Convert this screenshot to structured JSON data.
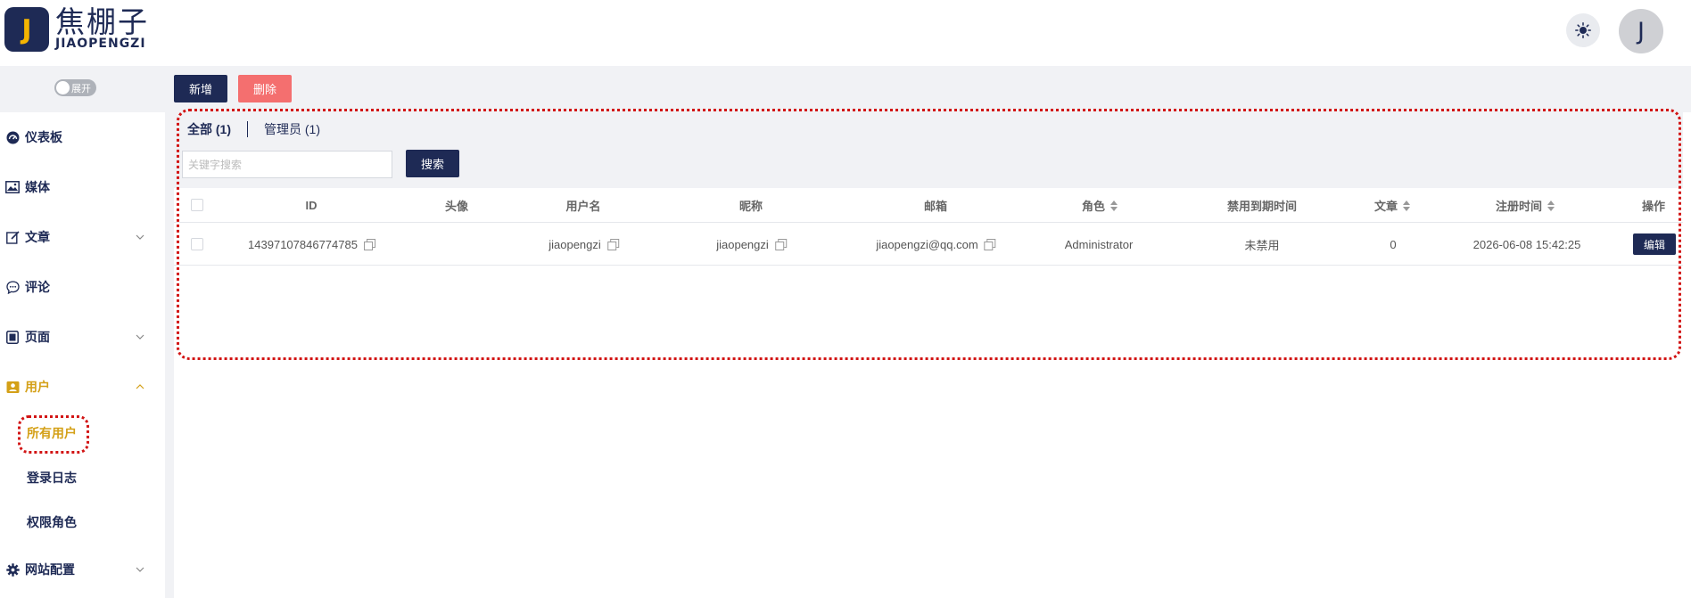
{
  "header": {
    "logo_letter": "J",
    "logo_cn": "焦棚子",
    "logo_en": "JIAOPENGZI",
    "theme_icon": "sun-icon",
    "avatar_letter": "J"
  },
  "sidebar": {
    "toggle_label": "展开",
    "items": [
      {
        "label": "仪表板",
        "icon": "dashboard-icon"
      },
      {
        "label": "媒体",
        "icon": "media-icon"
      },
      {
        "label": "文章",
        "icon": "article-icon"
      },
      {
        "label": "评论",
        "icon": "comment-icon"
      },
      {
        "label": "页面",
        "icon": "page-icon"
      },
      {
        "label": "用户",
        "icon": "user-icon"
      },
      {
        "label": "网站配置",
        "icon": "gear-icon"
      }
    ],
    "user_sub": [
      {
        "label": "所有用户"
      },
      {
        "label": "登录日志"
      },
      {
        "label": "权限角色"
      }
    ]
  },
  "toolbar": {
    "add_label": "新增",
    "delete_label": "删除"
  },
  "tabs": {
    "all": "全部 (1)",
    "admin": "管理员 (1)"
  },
  "search": {
    "placeholder": "关键字搜索",
    "button": "搜索"
  },
  "table": {
    "headers": {
      "id": "ID",
      "avatar": "头像",
      "username": "用户名",
      "nickname": "昵称",
      "email": "邮箱",
      "role": "角色",
      "ban_until": "禁用到期时间",
      "articles": "文章",
      "registered": "注册时间",
      "actions": "操作"
    },
    "rows": [
      {
        "id": "14397107846774785",
        "username": "jiaopengzi",
        "nickname": "jiaopengzi",
        "email": "jiaopengzi@qq.com",
        "role": "Administrator",
        "ban_until": "未禁用",
        "articles": "0",
        "registered": "2026-06-08 15:42:25",
        "edit_label": "编辑"
      }
    ]
  },
  "colors": {
    "brand": "#1e2a55",
    "accent": "#d4a017",
    "danger": "#f46f6f",
    "highlight": "#d21414"
  }
}
